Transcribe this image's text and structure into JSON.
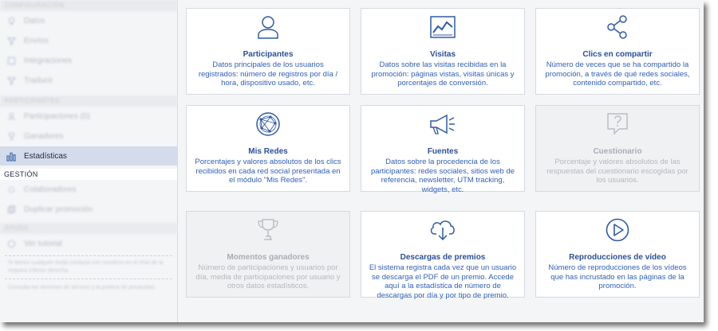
{
  "sidebar": {
    "section_top": "CONFIGURACIÓN",
    "items_top": [
      {
        "label": "Datos",
        "icon": "bulb-icon"
      },
      {
        "label": "Envíos",
        "icon": "filter-icon"
      },
      {
        "label": "Integraciones",
        "icon": "puzzle-icon"
      },
      {
        "label": "Traducir",
        "icon": "filter-icon"
      }
    ],
    "section_mid": "PARTICIPANTES",
    "items_mid": [
      {
        "label": "Participaciones (0)",
        "icon": "person-icon"
      },
      {
        "label": "Ganadores",
        "icon": "trophy-icon"
      }
    ],
    "active_item": {
      "label": "Estadísticas",
      "icon": "bar-chart-icon"
    },
    "gestion_label": "GESTIÓN",
    "items_gestion": [
      {
        "label": "Colaboradores",
        "icon": "gear-icon"
      },
      {
        "label": "Duplicar promoción",
        "icon": "copy-icon"
      }
    ],
    "section_bottom": "AYUDA",
    "items_bottom": [
      {
        "label": "Ver tutorial",
        "icon": "info-icon"
      }
    ],
    "note_1": "Si tienes cualquier duda contacta con nosotros en el chat de la esquina inferior derecha.",
    "note_2": "Consulta los términos de servicio y la política de privacidad."
  },
  "cards": [
    {
      "title": "Participantes",
      "desc": "Datos principales de los usuarios registrados: número de registros por día / hora, dispositivo usado, etc.",
      "icon": "user-icon",
      "disabled": false
    },
    {
      "title": "Visitas",
      "desc": "Datos sobre las visitas recibidas en la promoción: páginas vistas, visitas únicas y porcentajes de conversión.",
      "icon": "line-chart-icon",
      "disabled": false
    },
    {
      "title": "Clics en compartir",
      "desc": "Número de veces que se ha compartido la promoción, a través de qué redes sociales, contenido compartido, etc.",
      "icon": "share-icon",
      "disabled": false
    },
    {
      "title": "Mis Redes",
      "desc": "Porcentajes y valores absolutos de los clics recibidos en cada red social presentada en el módulo \"Mis Redes\".",
      "icon": "network-globe-icon",
      "disabled": false
    },
    {
      "title": "Fuentes",
      "desc": "Datos sobre la procedencia de los participantes: redes sociales, sitios web de referencia, newsletter, UTM tracking, widgets, etc.",
      "icon": "megaphone-icon",
      "disabled": false
    },
    {
      "title": "Cuestionario",
      "desc": "Porcentaje y valores absolutos de las respuestas del cuestionario escogidas por los usuarios.",
      "icon": "question-bubble-icon",
      "disabled": true
    },
    {
      "title": "Momentos ganadores",
      "desc": "Número de participaciones y usuarios por día, media de participaciones por usuario y otros datos estadísticos.",
      "icon": "trophy-icon",
      "disabled": true
    },
    {
      "title": "Descargas de premios",
      "desc": "El sistema registra cada vez que un usuario se descarga el PDF de un premio. Accede aquí a la estadística de número de descargas por día y por tipo de premio.",
      "icon": "cloud-download-icon",
      "disabled": false
    },
    {
      "title": "Reproducciones de vídeo",
      "desc": "Número de reproducciones de los vídeos que has incrustado en las páginas de la promoción.",
      "icon": "play-circle-icon",
      "disabled": false
    }
  ]
}
